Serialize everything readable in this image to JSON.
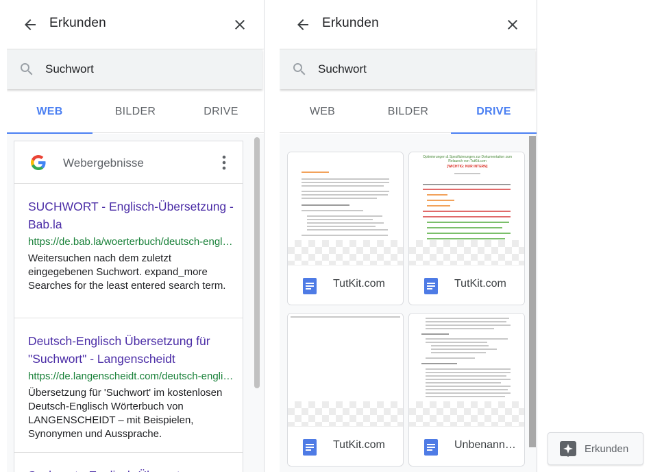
{
  "left_panel": {
    "title": "Erkunden",
    "search": {
      "value": "Suchwort"
    },
    "tabs": [
      {
        "label": "WEB",
        "active": true
      },
      {
        "label": "BILDER",
        "active": false
      },
      {
        "label": "DRIVE",
        "active": false
      }
    ],
    "web_card": {
      "header_label": "Webergebnisse",
      "results": [
        {
          "title": "SUCHWORT - Englisch-Übersetzung - Bab.la",
          "url": "https://de.bab.la/woerterbuch/deutsch-englisch/suchwort",
          "snippet": "Weitersuchen nach dem zuletzt eingegebenen Suchwort. expand_more Searches for the least entered search term."
        },
        {
          "title": "Deutsch-Englisch Übersetzung für \"Suchwort\" - Langenscheidt",
          "url": "https://de.langenscheidt.com/deutsch-englisch/suchwort",
          "snippet": "Übersetzung für 'Suchwort' im kostenlosen Deutsch-Englisch Wörterbuch von LANGENSCHEIDT – mit Beispielen, Synonymen und Aussprache."
        },
        {
          "title": "Suchwort - Englisch-Übersetzung",
          "url": "",
          "snippet": ""
        }
      ]
    }
  },
  "right_panel": {
    "title": "Erkunden",
    "search": {
      "value": "Suchwort"
    },
    "tabs": [
      {
        "label": "WEB",
        "active": false
      },
      {
        "label": "BILDER",
        "active": false
      },
      {
        "label": "DRIVE",
        "active": true
      }
    ],
    "drive_items": [
      {
        "name": "TutKit.com"
      },
      {
        "name": "TutKit.com"
      },
      {
        "name": "TutKit.com"
      },
      {
        "name": "Unbenanntes Dokument"
      }
    ],
    "thumb_texts": {
      "doc2_title": "Optimierungen & Spezifizierungen zur Dokumentation zum Relaunch von TutKit.com",
      "doc2_subtitle": "[WICHTIG: NUR INTERN]"
    }
  },
  "explore_button": {
    "label": "Erkunden"
  },
  "colors": {
    "accent": "#4a7ff2",
    "result_title": "#4a2ca6",
    "result_url": "#188038",
    "docs_icon": "#4e7be5"
  }
}
